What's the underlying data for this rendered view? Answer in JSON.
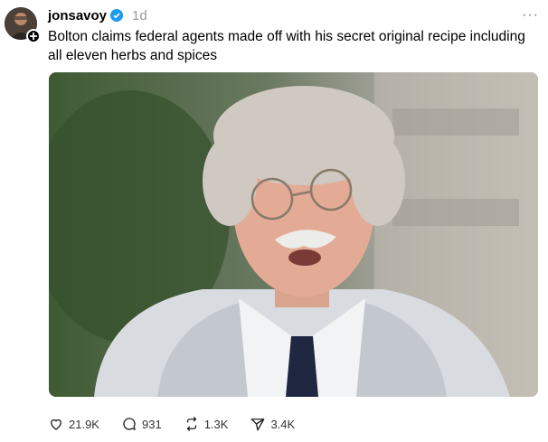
{
  "post": {
    "username": "jonsavoy",
    "time": "1d",
    "more_label": "···",
    "text": "Bolton claims federal agents made off with his secret original recipe including all eleven herbs and spices"
  },
  "actions": {
    "likes": "21.9K",
    "replies": "931",
    "reposts": "1.3K",
    "shares": "3.4K"
  },
  "icons": [
    "plus-icon",
    "verified-badge-icon",
    "heart-icon",
    "comment-icon",
    "repost-icon",
    "share-icon"
  ]
}
